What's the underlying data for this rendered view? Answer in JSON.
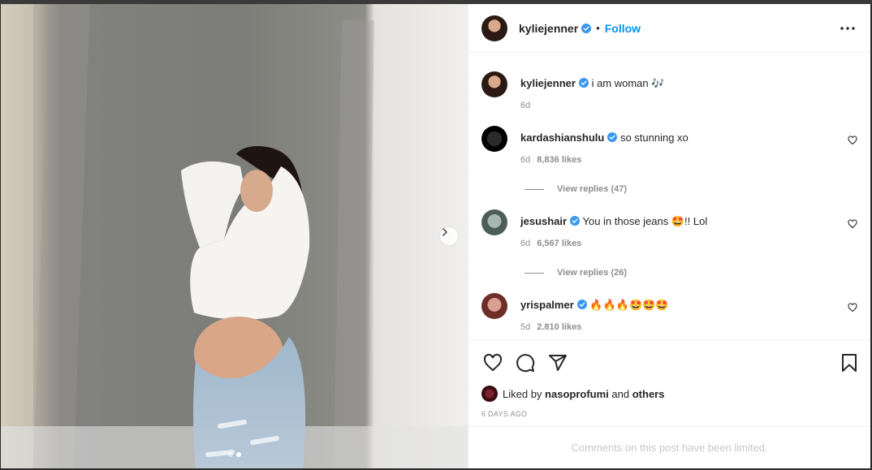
{
  "post": {
    "username": "kyliejenner",
    "follow_label": "Follow",
    "bullet": "•",
    "caption": "i am woman 🎶",
    "caption_time": "6d"
  },
  "comments": [
    {
      "username": "kardashianshulu",
      "text": "so stunning xo",
      "time": "6d",
      "likes": "8,836 likes",
      "replies": "View replies (47)"
    },
    {
      "username": "jesushair",
      "text": "You in those jeans 🤩!! Lol",
      "time": "6d",
      "likes": "6,567 likes",
      "replies": "View replies (26)"
    },
    {
      "username": "yrispalmer",
      "text": "🔥🔥🔥🤩🤩🤩",
      "time": "5d",
      "likes": "2.810 likes"
    }
  ],
  "liked_by": {
    "prefix": "Liked by",
    "user": "nasoprofumi",
    "and": "and",
    "others": "others"
  },
  "date_label": "6 DAYS AGO",
  "limited_text": "Comments on this post have been limited.",
  "carousel": {
    "total": 2,
    "current": 2
  },
  "colors": {
    "link": "#0095f6",
    "verified": "#3897f0",
    "muted": "#8e8e8e"
  },
  "icons": [
    "heart-icon",
    "comment-icon",
    "share-icon",
    "bookmark-icon",
    "more-icon",
    "verified-icon",
    "chevron-right-icon"
  ]
}
